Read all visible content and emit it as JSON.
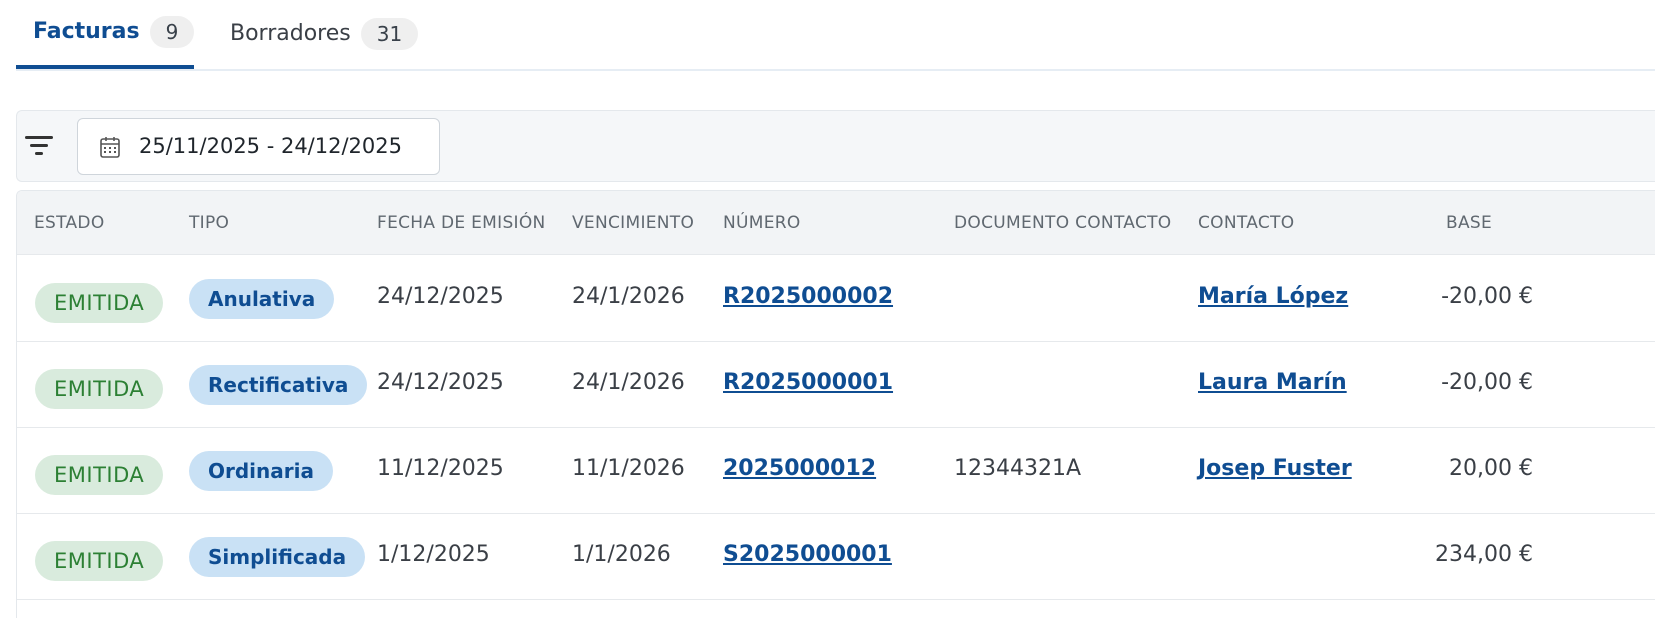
{
  "tabs": [
    {
      "label": "Facturas",
      "count": "9",
      "active": true
    },
    {
      "label": "Borradores",
      "count": "31",
      "active": false
    }
  ],
  "filters": {
    "filter_icon": "filter-icon",
    "date_icon": "calendar-icon",
    "date_range": "25/11/2025 - 24/12/2025"
  },
  "table": {
    "headers": {
      "estado": "ESTADO",
      "tipo": "TIPO",
      "fecha": "FECHA DE EMISIÓN",
      "vencimiento": "VENCIMIENTO",
      "numero": "NÚMERO",
      "documento": "DOCUMENTO CONTACTO",
      "contacto": "CONTACTO",
      "base": "BASE"
    },
    "rows": [
      {
        "estado": "EMITIDA",
        "tipo": "Anulativa",
        "fecha": "24/12/2025",
        "vencimiento": "24/1/2026",
        "numero": "R2025000002",
        "documento": "",
        "contacto": "María López",
        "base": "-20,00 €"
      },
      {
        "estado": "EMITIDA",
        "tipo": "Rectificativa",
        "fecha": "24/12/2025",
        "vencimiento": "24/1/2026",
        "numero": "R2025000001",
        "documento": "",
        "contacto": "Laura Marín",
        "base": "-20,00 €"
      },
      {
        "estado": "EMITIDA",
        "tipo": "Ordinaria",
        "fecha": "11/12/2025",
        "vencimiento": "11/1/2026",
        "numero": "2025000012",
        "documento": "12344321A",
        "contacto": "Josep Fuster",
        "base": "20,00 €"
      },
      {
        "estado": "EMITIDA",
        "tipo": "Simplificada",
        "fecha": "1/12/2025",
        "vencimiento": "1/1/2026",
        "numero": "S2025000001",
        "documento": "",
        "contacto": "",
        "base": "234,00 €"
      }
    ]
  },
  "colors": {
    "primary": "#0f4d92",
    "estado_bg": "#d9ebdd",
    "estado_text": "#2c8034",
    "tipo_bg": "#c9e1f5"
  }
}
